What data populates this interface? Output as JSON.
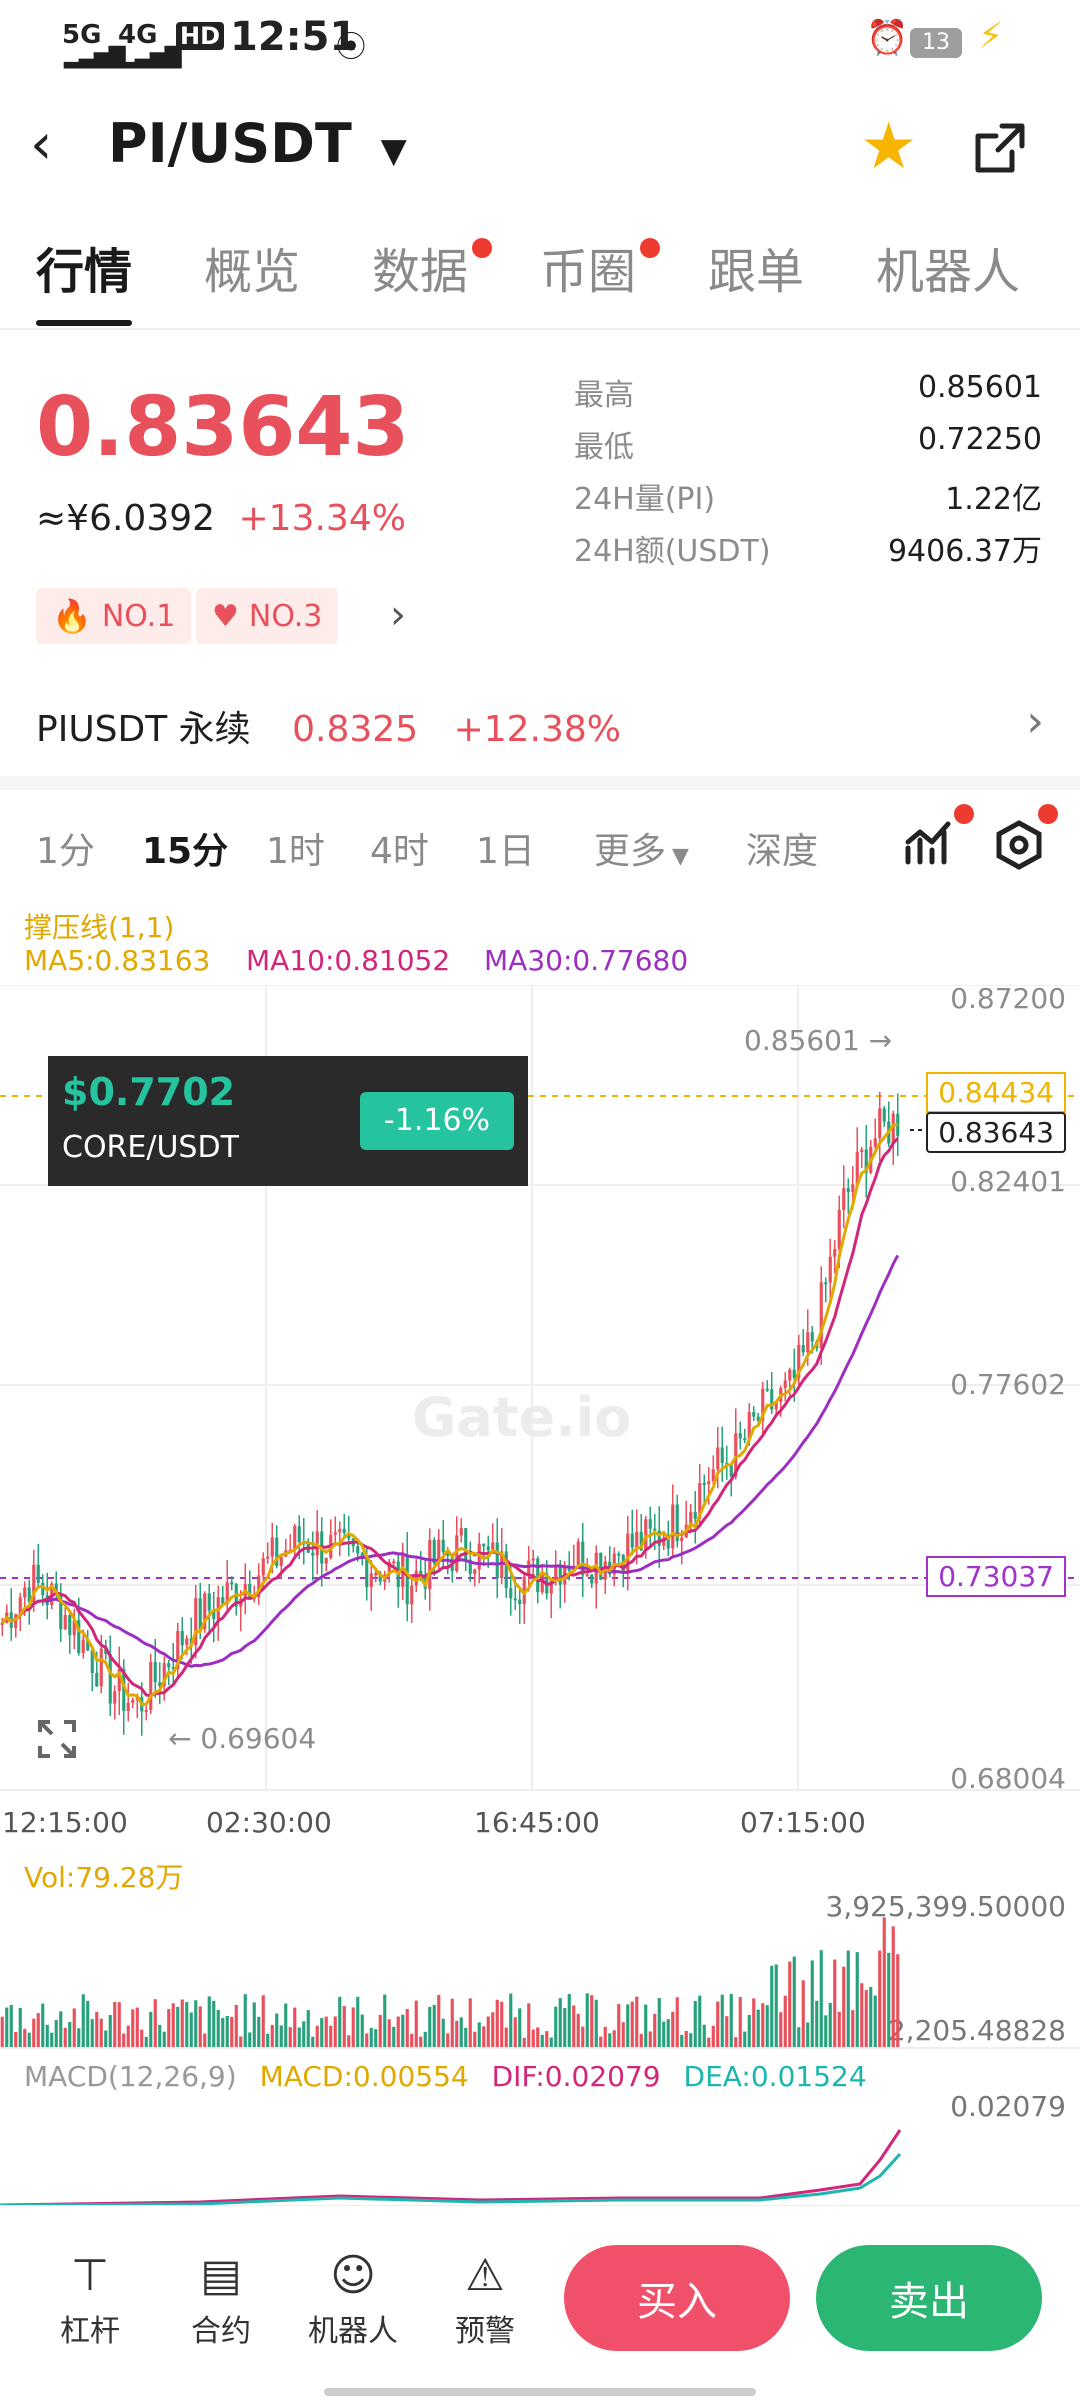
{
  "status_bar": {
    "network1": "5G",
    "network2": "4G",
    "hd": "HD",
    "time": "12:51",
    "battery": "13"
  },
  "header": {
    "pair": "PI/USDT",
    "tabs": [
      {
        "label": "行情",
        "active": true,
        "dot": false
      },
      {
        "label": "概览",
        "active": false,
        "dot": false
      },
      {
        "label": "数据",
        "active": false,
        "dot": true
      },
      {
        "label": "币圈",
        "active": false,
        "dot": true
      },
      {
        "label": "跟单",
        "active": false,
        "dot": false
      },
      {
        "label": "机器人",
        "active": false,
        "dot": false
      }
    ]
  },
  "ticker": {
    "price": "0.83643",
    "cny": "≈¥6.0392",
    "change": "+13.34%",
    "badges": [
      "NO.1",
      "NO.3"
    ],
    "stats": [
      {
        "label": "最高",
        "value": "0.85601"
      },
      {
        "label": "最低",
        "value": "0.72250"
      },
      {
        "label": "24H量(PI)",
        "value": "1.22亿"
      },
      {
        "label": "24H额(USDT)",
        "value": "9406.37万"
      }
    ]
  },
  "perpetual": {
    "name": "PIUSDT 永续",
    "price": "0.8325",
    "change": "+12.38%"
  },
  "timeframes": {
    "items": [
      "1分",
      "15分",
      "1时",
      "4时",
      "1日"
    ],
    "active": "15分",
    "more": "更多",
    "depth": "深度"
  },
  "indicators": {
    "sr_line": "撑压线(1,1)",
    "ma5": "MA5:0.83163",
    "ma10": "MA10:0.81052",
    "ma30": "MA30:0.77680",
    "vol": "Vol:79.28万",
    "macd_title": "MACD(12,26,9)",
    "macd": "MACD:0.00554",
    "dif": "DIF:0.02079",
    "dea": "DEA:0.01524"
  },
  "chart_data": {
    "type": "line",
    "title": "",
    "y_ticks": [
      "0.87200",
      "0.82401",
      "0.77602",
      "0.68004"
    ],
    "x_ticks": [
      "12:15:00",
      "02:30:00",
      "16:45:00",
      "07:15:00"
    ],
    "high_marker": "0.85601",
    "low_marker": "0.69604",
    "last_price_label": "0.83643",
    "line_label_orange": "0.84434",
    "line_label_purple": "0.73037",
    "ylim": [
      0.68004,
      0.872
    ],
    "close_series": [
      0.72,
      0.73,
      0.725,
      0.715,
      0.705,
      0.7,
      0.71,
      0.72,
      0.725,
      0.73,
      0.735,
      0.74,
      0.738,
      0.735,
      0.733,
      0.73,
      0.735,
      0.738,
      0.735,
      0.73,
      0.732,
      0.736,
      0.735,
      0.738,
      0.74,
      0.745,
      0.755,
      0.76,
      0.77,
      0.775,
      0.79,
      0.82,
      0.835,
      0.84
    ],
    "volume": {
      "max_label": "3,925,399.50000",
      "min_label": "2,205.48828"
    },
    "macd_axis": "0.02079",
    "popup": {
      "price": "$0.7702",
      "pair": "CORE/USDT",
      "change": "-1.16%"
    },
    "watermark": "Gate.io"
  },
  "bottom_nav": {
    "items": [
      {
        "label": "杠杆",
        "icon": "lever-icon"
      },
      {
        "label": "合约",
        "icon": "contract-icon"
      },
      {
        "label": "机器人",
        "icon": "robot-icon"
      },
      {
        "label": "预警",
        "icon": "alarm-icon"
      }
    ],
    "buy": "买入",
    "sell": "卖出"
  },
  "colors": {
    "up": "#e8505b",
    "down": "#26a17b",
    "buy": "#f0506a",
    "sell": "#2bb673"
  }
}
